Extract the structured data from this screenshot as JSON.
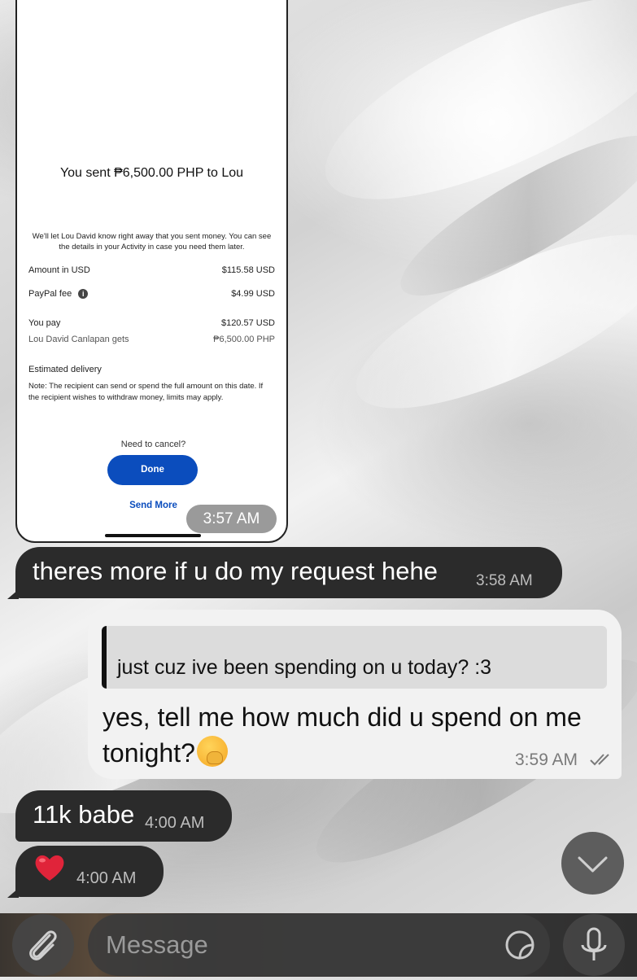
{
  "screenshot": {
    "title": "You sent ₱6,500.00 PHP to Lou",
    "notice": "We'll let Lou David know right away that you sent money. You can see the details in your Activity in case you need them later.",
    "rows": [
      {
        "label": "Amount in USD",
        "value": "$115.58 USD"
      },
      {
        "label": "PayPal fee",
        "value": "$4.99 USD"
      },
      {
        "label": "You pay",
        "value": "$120.57 USD"
      },
      {
        "label": "Lou David Canlapan gets",
        "value": "₱6,500.00 PHP"
      }
    ],
    "estimated_title": "Estimated delivery",
    "estimated_note": "Note: The recipient can send or spend the full amount on this date. If the recipient wishes to withdraw money, limits may apply.",
    "cancel_text": "Need to cancel?",
    "done_label": "Done",
    "send_more_label": "Send More",
    "time": "3:57 AM"
  },
  "messages": [
    {
      "text": "theres more if u do my request hehe",
      "time": "3:58 AM"
    },
    {
      "reply_quote": "just cuz ive been spending on u today? :3",
      "text": "yes, tell me how much did u spend on me tonight?",
      "time": "3:59 AM"
    },
    {
      "text": "11k babe",
      "time": "4:00 AM"
    },
    {
      "text": "❤️",
      "time": "4:00 AM"
    }
  ],
  "input": {
    "placeholder": "Message"
  },
  "colors": {
    "paypal_blue": "#0b4dbd",
    "dark_bubble": "#2b2b2b",
    "light_bubble": "#f2f2f2",
    "heart": "#e0243a"
  },
  "icons": [
    "info-icon",
    "double-check-icon",
    "chevron-down-icon",
    "paperclip-icon",
    "sticker-icon",
    "microphone-icon",
    "heart-emoji",
    "hand-over-mouth-emoji"
  ]
}
